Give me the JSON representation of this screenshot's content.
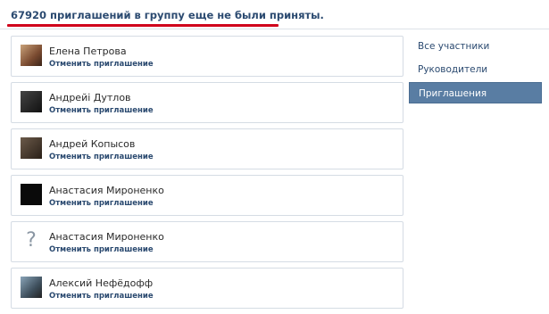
{
  "header": {
    "title": "67920 приглашений в группу еще не были приняты."
  },
  "invitations": [
    {
      "name": "Елена Петрова",
      "action": "Отменить приглашение",
      "avatar": "photo-light"
    },
    {
      "name": "Андрейі Дутлов",
      "action": "Отменить приглашение",
      "avatar": "photo-dark"
    },
    {
      "name": "Андрей Копысов",
      "action": "Отменить приглашение",
      "avatar": "photo-mid"
    },
    {
      "name": "Анастасия Мироненко",
      "action": "Отменить приглашение",
      "avatar": "photo-black"
    },
    {
      "name": "Анастасия Мироненко",
      "action": "Отменить приглашение",
      "avatar": "placeholder"
    },
    {
      "name": "Алексий Нефёдофф",
      "action": "Отменить приглашение",
      "avatar": "photo-blue"
    }
  ],
  "placeholder_glyph": "?",
  "sidebar": {
    "items": [
      {
        "label": "Все участники",
        "active": false
      },
      {
        "label": "Руководители",
        "active": false
      },
      {
        "label": "Приглашения",
        "active": true
      }
    ]
  },
  "colors": {
    "link": "#2b4a70",
    "accent_underline": "#d0021b",
    "active_tab": "#597da3",
    "card_border": "#d5dce4"
  }
}
